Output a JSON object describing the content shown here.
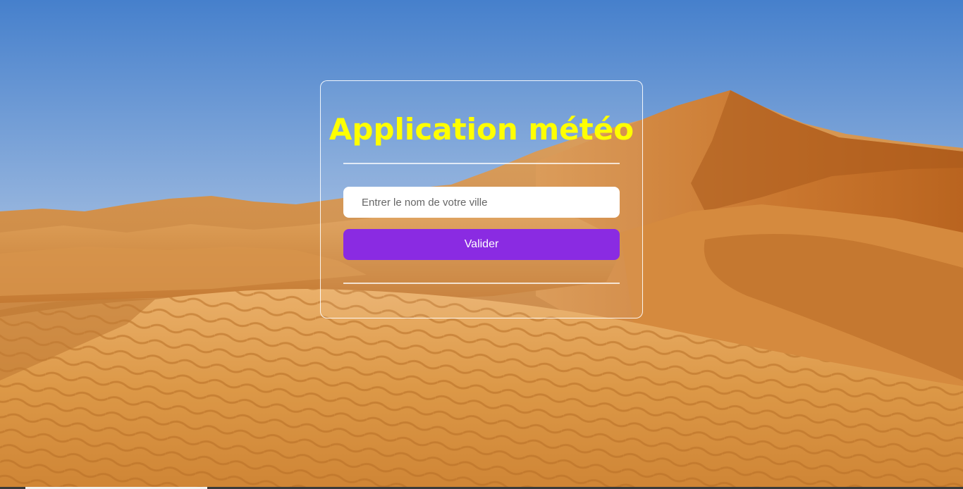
{
  "app": {
    "title": "Application météo"
  },
  "form": {
    "city_placeholder": "Entrer le nom de votre ville",
    "city_value": "",
    "submit_label": "Valider"
  },
  "colors": {
    "title": "#ffff00",
    "button": "#8a2be2",
    "input_background": "#ffffff"
  },
  "background": {
    "icon": "desert-dunes-photo"
  }
}
